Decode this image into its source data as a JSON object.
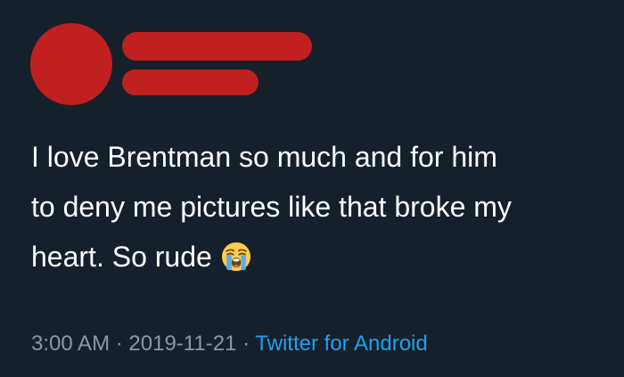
{
  "colors": {
    "background": "#16202b",
    "redaction": "#c0201f",
    "text_primary": "#ffffff",
    "text_secondary": "#8899a6",
    "link": "#1da1f2"
  },
  "author": {
    "avatar_icon": "redacted-avatar",
    "name": "",
    "handle": ""
  },
  "tweet": {
    "line1": "I love Brentman so much and for him",
    "line2": "to deny me pictures like that broke my",
    "line3": "heart. So rude",
    "emoji_icon": "loudly-crying-face-icon"
  },
  "meta": {
    "time": "3:00 AM",
    "separator": "·",
    "date": "2019-11-21",
    "source": "Twitter for Android"
  }
}
